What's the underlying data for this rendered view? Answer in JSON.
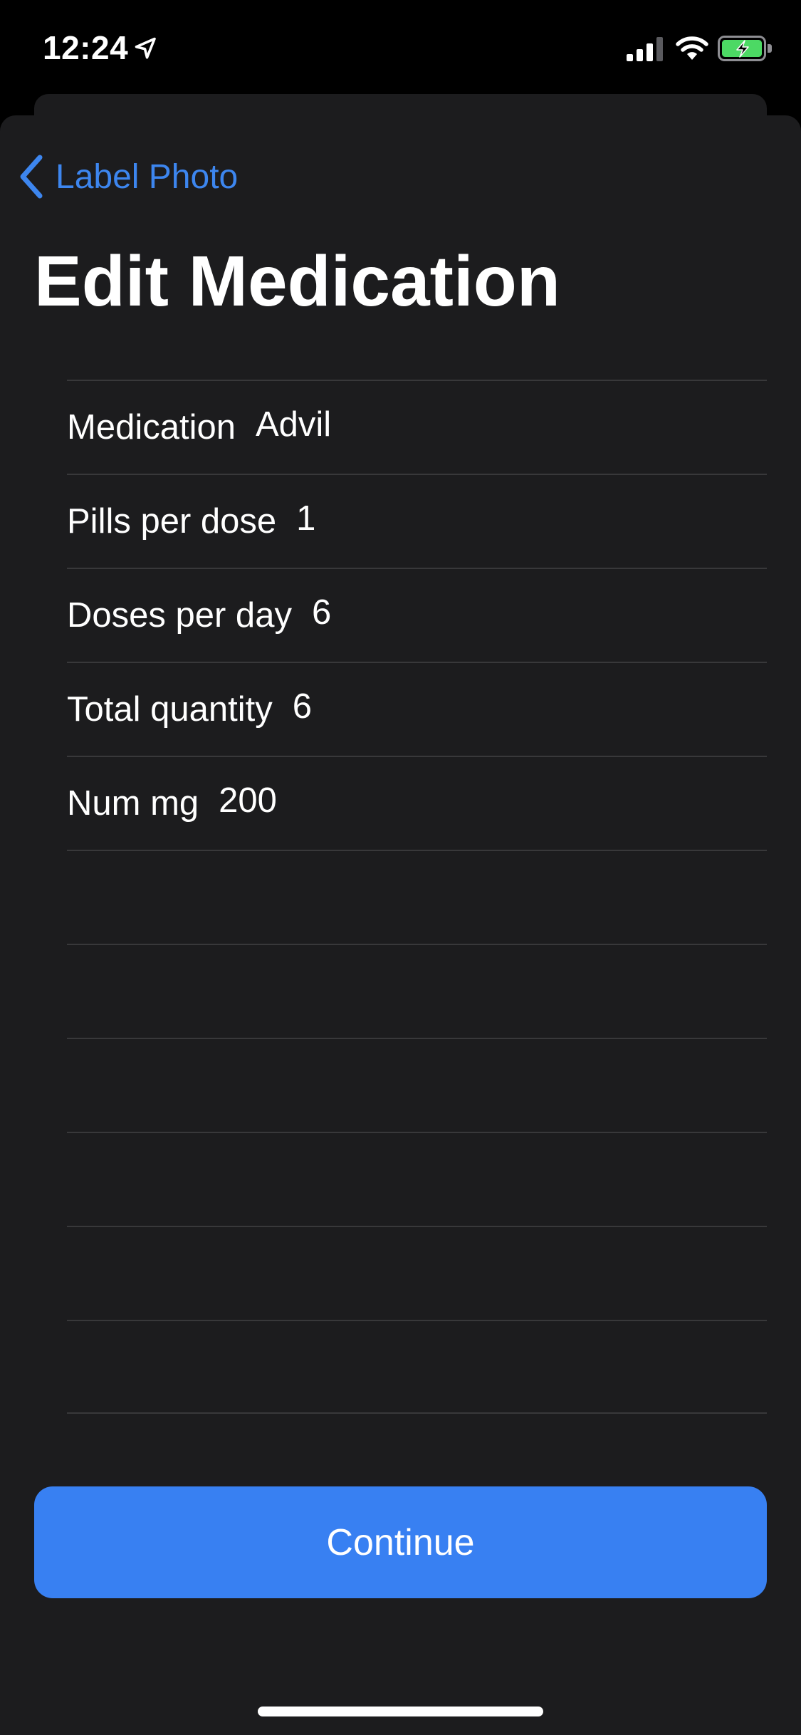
{
  "status_bar": {
    "time": "12:24",
    "icons": [
      "location-arrow-icon",
      "cellular-signal-icon",
      "wifi-icon",
      "battery-charging-icon"
    ],
    "battery_color": "#4cd964"
  },
  "nav": {
    "back_label": "Label Photo",
    "back_icon": "chevron-left-icon"
  },
  "title": "Edit Medication",
  "form": {
    "rows": [
      {
        "label": "Medication",
        "value": "Advil"
      },
      {
        "label": "Pills per dose",
        "value": "1"
      },
      {
        "label": "Doses per day",
        "value": "6"
      },
      {
        "label": "Total quantity",
        "value": "6"
      },
      {
        "label": "Num mg",
        "value": "200"
      },
      {
        "label": "",
        "value": ""
      },
      {
        "label": "",
        "value": ""
      },
      {
        "label": "",
        "value": ""
      },
      {
        "label": "",
        "value": ""
      },
      {
        "label": "",
        "value": ""
      },
      {
        "label": "",
        "value": ""
      }
    ]
  },
  "continue_label": "Continue",
  "colors": {
    "accent": "#3d86ef",
    "button": "#3880f2",
    "sheet_background": "#1c1c1e",
    "separator": "#38383a"
  }
}
